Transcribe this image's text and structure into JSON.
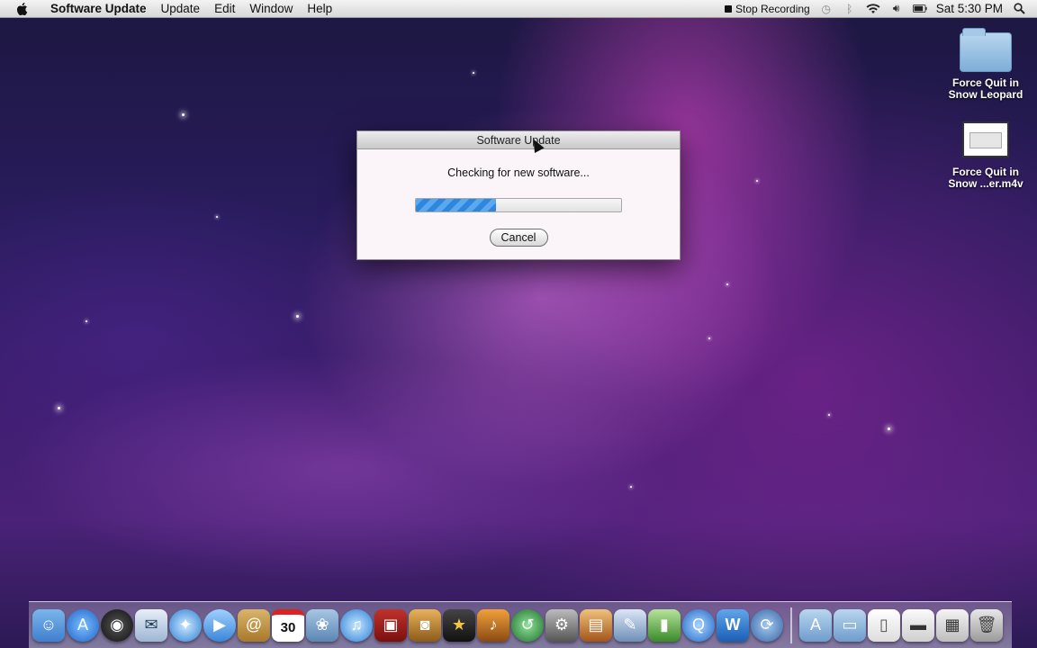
{
  "menubar": {
    "app_name": "Software Update",
    "menus": [
      "Update",
      "Edit",
      "Window",
      "Help"
    ],
    "stop_recording": "Stop Recording",
    "clock": "Sat 5:30 PM"
  },
  "desktop": {
    "icon1_label": "Force Quit in Snow Leopard",
    "icon2_label": "Force Quit in Snow ...er.m4v"
  },
  "dialog": {
    "title": "Software Update",
    "message": "Checking for new software...",
    "progress": 0.39,
    "cancel_label": "Cancel"
  },
  "dock": {
    "calendar_day": "30",
    "icons": [
      "finder-icon",
      "app-store-icon",
      "dashboard-icon",
      "mail-icon",
      "safari-icon",
      "facetime-icon",
      "address-book-icon",
      "ical-icon",
      "iphoto-icon",
      "itunes-icon",
      "photo-booth-icon",
      "image-capture-icon",
      "imovie-icon",
      "garageband-icon",
      "time-machine-icon",
      "system-preferences-icon",
      "keynote-icon",
      "pages-icon",
      "numbers-icon",
      "quicktime-icon",
      "word-icon",
      "sync-icon",
      "applications-folder-icon",
      "documents-folder-icon",
      "document-icon",
      "movie-file-icon",
      "screenshot-icon",
      "trash-icon"
    ]
  },
  "colors": {
    "accent": "#2f86df",
    "menubar": "#e6e6e6"
  }
}
